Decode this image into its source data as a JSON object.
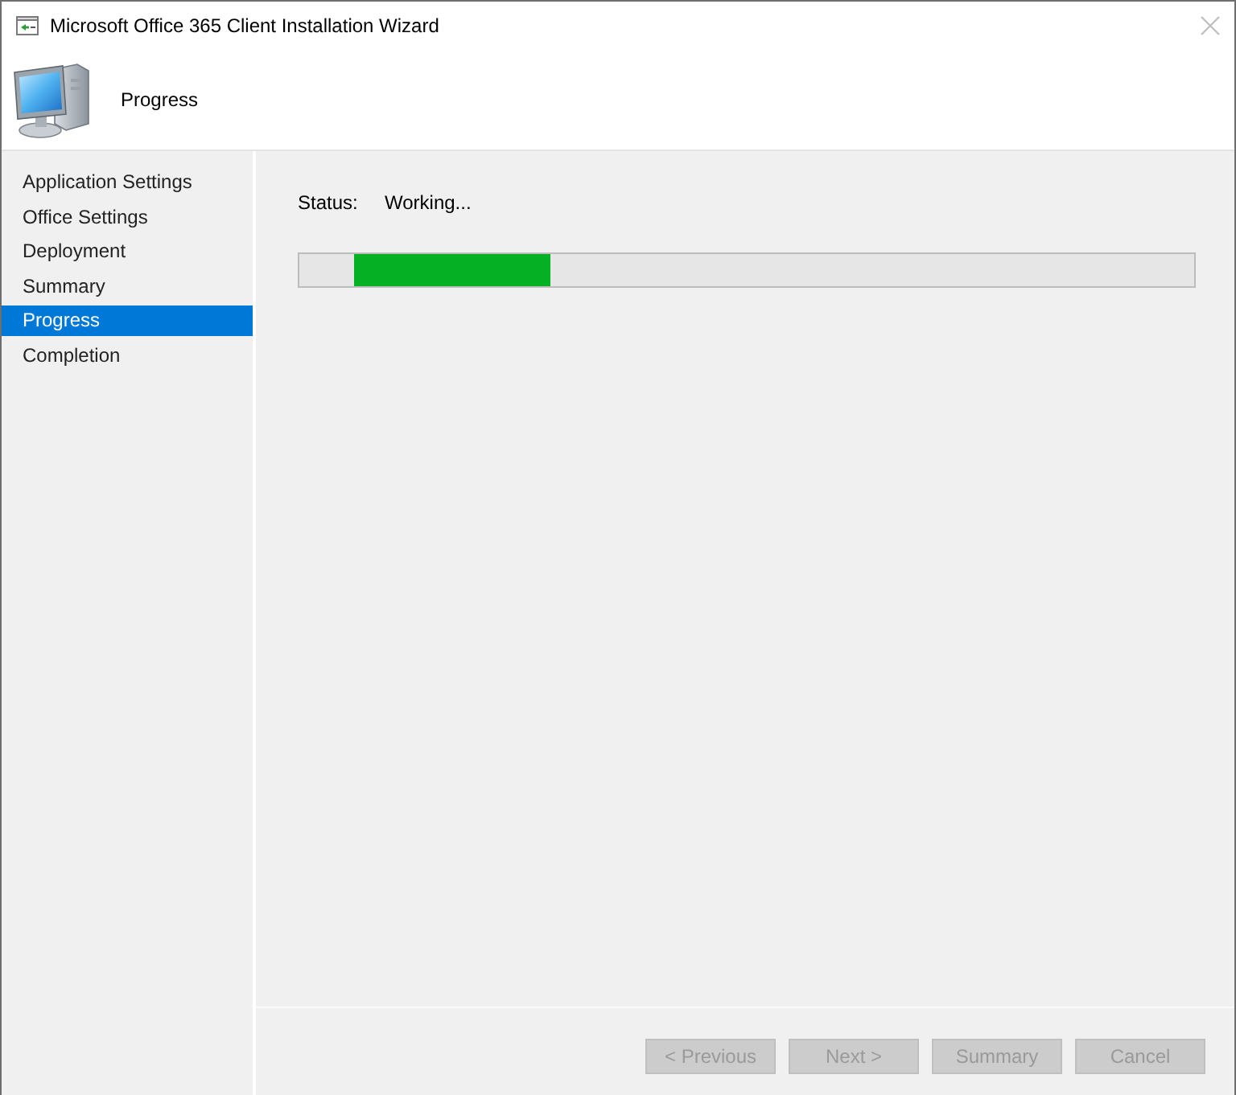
{
  "window": {
    "title": "Microsoft Office 365 Client Installation Wizard"
  },
  "header": {
    "title": "Progress"
  },
  "sidebar": {
    "items": [
      {
        "label": "Application Settings",
        "selected": false
      },
      {
        "label": "Office Settings",
        "selected": false
      },
      {
        "label": "Deployment",
        "selected": false
      },
      {
        "label": "Summary",
        "selected": false
      },
      {
        "label": "Progress",
        "selected": true
      },
      {
        "label": "Completion",
        "selected": false
      }
    ]
  },
  "status": {
    "label": "Status:",
    "value": "Working..."
  },
  "progress": {
    "level": 0.22
  },
  "buttons": [
    {
      "label": "< Previous",
      "disabled": true
    },
    {
      "label": "Next >",
      "disabled": true
    },
    {
      "label": "Summary",
      "disabled": true
    },
    {
      "label": "Cancel",
      "disabled": true
    }
  ]
}
